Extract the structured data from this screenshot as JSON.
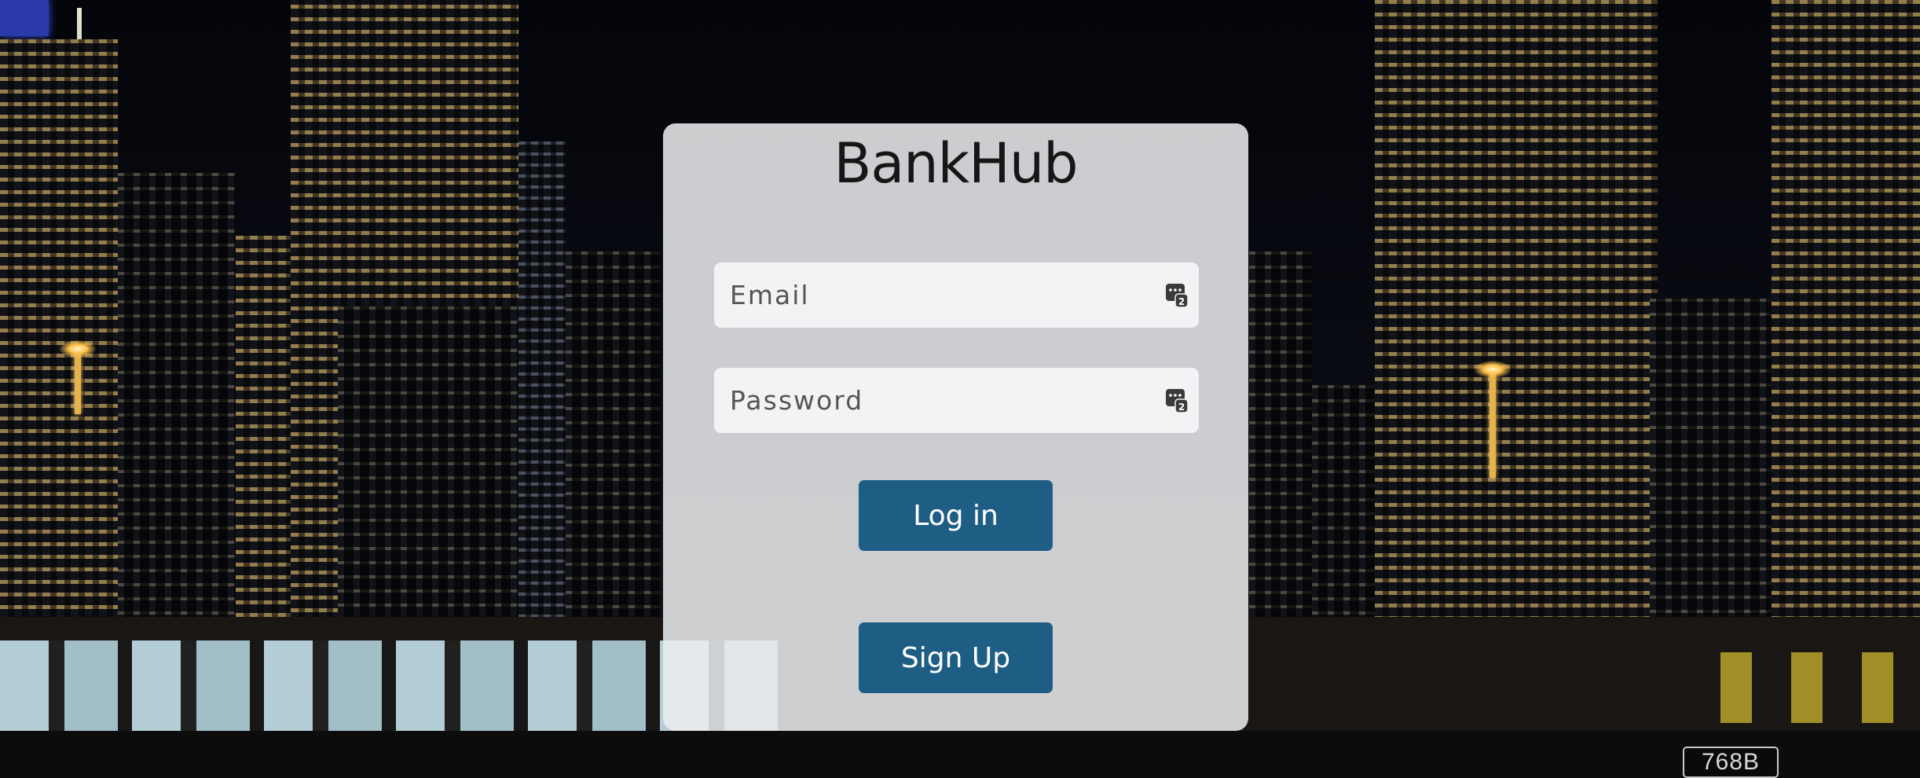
{
  "app": {
    "brand_title": "BankHub"
  },
  "login_form": {
    "email_placeholder": "Email",
    "email_value": "",
    "password_placeholder": "Password",
    "password_value": "",
    "login_label": "Log in",
    "signup_label": "Sign Up",
    "autofill_icon": "password-autofill-key-icon"
  },
  "background": {
    "plate_text": "768B"
  },
  "colors": {
    "primary_button": "#1e5e85",
    "card_background": "#ecedf0",
    "brand_text": "#161616"
  }
}
